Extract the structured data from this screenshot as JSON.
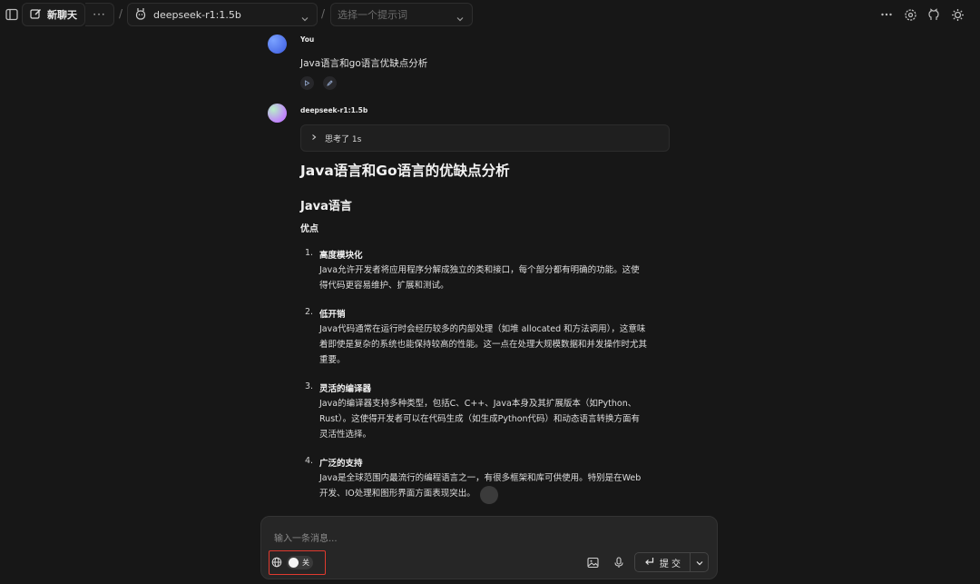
{
  "header": {
    "new_chat_label": "新聊天",
    "more_label": "···",
    "separator": "/",
    "model_label": "deepseek-r1:1.5b",
    "prompt_placeholder": "选择一个提示词"
  },
  "conversation": {
    "user": {
      "author": "You",
      "text": "Java语言和go语言优缺点分析"
    },
    "assistant": {
      "author": "deepseek-r1:1.5b",
      "thinking_label": "思考了 1s",
      "title": "Java语言和Go语言的优缺点分析",
      "section_title": "Java语言",
      "subsection_title": "优点",
      "items": [
        {
          "num": "1.",
          "title": "高度模块化",
          "body": "Java允许开发者将应用程序分解成独立的类和接口，每个部分都有明确的功能。这使得代码更容易维护、扩展和测试。"
        },
        {
          "num": "2.",
          "title": "低开销",
          "body": "Java代码通常在运行时会经历较多的内部处理（如堆 allocated 和方法调用），这意味着即使是复杂的系统也能保持较高的性能。这一点在处理大规模数据和并发操作时尤其重要。"
        },
        {
          "num": "3.",
          "title": "灵活的编译器",
          "body": "Java的编译器支持多种类型，包括C、C++、Java本身及其扩展版本（如Python、Rust）。这使得开发者可以在代码生成（如生成Python代码）和动态语言转换方面有灵活性选择。"
        },
        {
          "num": "4.",
          "title": "广泛的支持",
          "body": "Java是全球范围内最流行的编程语言之一，有很多框架和库可供使用。特别是在Web开发、IO处理和图形界面方面表现突出。"
        }
      ]
    }
  },
  "composer": {
    "placeholder": "输入一条消息...",
    "web_toggle_label": "关",
    "submit_label": "提 交"
  }
}
